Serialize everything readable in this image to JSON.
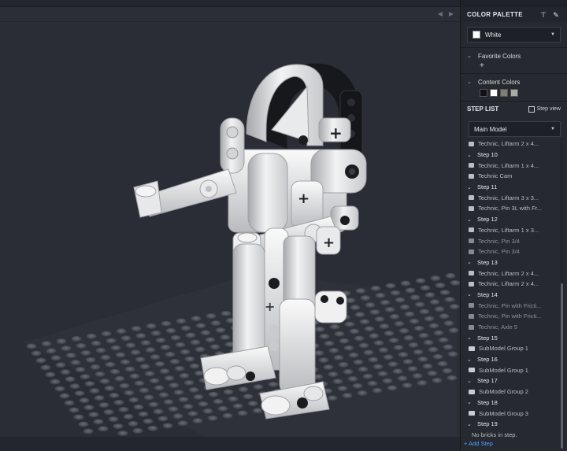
{
  "panel": {
    "title": "COLOR PALETTE",
    "color_select": {
      "label": "White",
      "swatch": "#ffffff"
    },
    "favorite_colors": {
      "label": "Favorite Colors",
      "add": "+"
    },
    "content_colors": {
      "label": "Content Colors",
      "swatches": [
        "#0f1116",
        "#ffffff",
        "#7c7e70",
        "#a9aba5"
      ]
    },
    "step_list": {
      "title": "STEP LIST",
      "step_view": "Step view",
      "model_select": "Main Model"
    },
    "add_step": "+ Add Step"
  },
  "steps": [
    {
      "kind": "item",
      "label": "Technic, Liftarm 2 x 4..."
    },
    {
      "kind": "step",
      "label": "Step 10"
    },
    {
      "kind": "item",
      "label": "Technic, Liftarm 1 x 4..."
    },
    {
      "kind": "item",
      "label": "Technic Cam"
    },
    {
      "kind": "step",
      "label": "Step 11"
    },
    {
      "kind": "item",
      "label": "Technic, Liftarm 3 x 3..."
    },
    {
      "kind": "item",
      "label": "Technic, Pin 3L with Fr..."
    },
    {
      "kind": "step",
      "label": "Step 12"
    },
    {
      "kind": "item",
      "label": "Technic, Liftarm 1 x 3..."
    },
    {
      "kind": "item",
      "label": "Technic, Pin 3/4",
      "dim": true
    },
    {
      "kind": "item",
      "label": "Technic, Pin 3/4",
      "dim": true
    },
    {
      "kind": "step",
      "label": "Step 13"
    },
    {
      "kind": "item",
      "label": "Technic, Liftarm 2 x 4..."
    },
    {
      "kind": "item",
      "label": "Technic, Liftarm 2 x 4..."
    },
    {
      "kind": "step",
      "label": "Step 14"
    },
    {
      "kind": "item",
      "label": "Technic, Pin with Fricti...",
      "dim": true
    },
    {
      "kind": "item",
      "label": "Technic, Pin with Fricti...",
      "dim": true
    },
    {
      "kind": "item",
      "label": "Technic, Axle 5",
      "dim": true
    },
    {
      "kind": "step",
      "label": "Step 15"
    },
    {
      "kind": "folder",
      "label": "SubModel Group 1"
    },
    {
      "kind": "step",
      "label": "Step 16"
    },
    {
      "kind": "folder",
      "label": "SubModel Group 1"
    },
    {
      "kind": "step",
      "label": "Step 17"
    },
    {
      "kind": "folder",
      "label": "SubModel Group 2"
    },
    {
      "kind": "step",
      "label": "Step 18"
    },
    {
      "kind": "folder",
      "label": "SubModel Group 3"
    },
    {
      "kind": "step",
      "label": "Step 19"
    },
    {
      "kind": "note",
      "label": "No bricks in step."
    }
  ]
}
